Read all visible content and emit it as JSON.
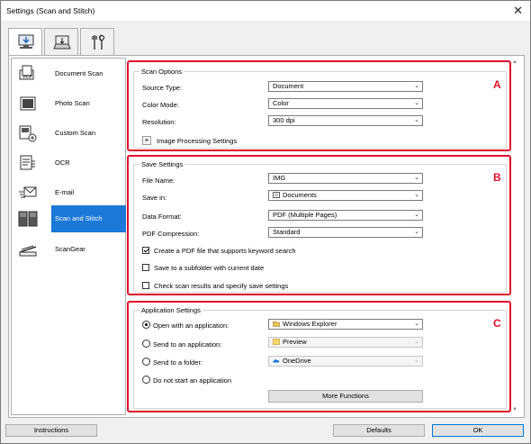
{
  "window": {
    "title": "Settings (Scan and Stitch)",
    "close_glyph": "✕"
  },
  "tabs": [
    {
      "name": "scan-from-computer-tab",
      "icon": "computer-scan-icon"
    },
    {
      "name": "scan-from-operation-panel-tab",
      "icon": "device-scan-icon"
    },
    {
      "name": "general-settings-tab",
      "icon": "tools-icon"
    }
  ],
  "sidebar": {
    "items": [
      {
        "label": "Document Scan",
        "icon": "document-scan-icon"
      },
      {
        "label": "Photo Scan",
        "icon": "photo-scan-icon"
      },
      {
        "label": "Custom Scan",
        "icon": "custom-scan-icon"
      },
      {
        "label": "OCR",
        "icon": "ocr-icon"
      },
      {
        "label": "E-mail",
        "icon": "email-icon"
      },
      {
        "label": "Scan and Stitch",
        "icon": "scan-and-stitch-icon",
        "active": true
      },
      {
        "label": "ScanGear",
        "icon": "scangear-icon"
      }
    ]
  },
  "scan_options": {
    "title": "Scan Options",
    "marker": "A",
    "source_type": {
      "label": "Source Type:",
      "value": "Document"
    },
    "color_mode": {
      "label": "Color Mode:",
      "value": "Color"
    },
    "resolution": {
      "label": "Resolution:",
      "value": "300 dpi"
    },
    "image_processing": {
      "label": "Image Processing Settings",
      "toggle": "+"
    }
  },
  "save_settings": {
    "title": "Save Settings",
    "marker": "B",
    "file_name": {
      "label": "File Name:",
      "value": "IMG"
    },
    "save_in": {
      "label": "Save in:",
      "value": "Documents"
    },
    "data_format": {
      "label": "Data Format:",
      "value": "PDF (Multiple Pages)"
    },
    "pdf_compression": {
      "label": "PDF Compression:",
      "value": "Standard"
    },
    "keyword_search": {
      "label": "Create a PDF file that supports keyword search",
      "checked": true
    },
    "subfolder": {
      "label": "Save to a subfolder with current date",
      "checked": false
    },
    "check_results": {
      "label": "Check scan results and specify save settings",
      "checked": false
    }
  },
  "application_settings": {
    "title": "Application Settings",
    "marker": "C",
    "open_with": {
      "label": "Open with an application:",
      "value": "Windows Explorer",
      "selected": true
    },
    "send_to_app": {
      "label": "Send to an application:",
      "value": "Preview"
    },
    "send_to_folder": {
      "label": "Send to a folder:",
      "value": "OneDrive"
    },
    "do_not_start": {
      "label": "Do not start an application"
    },
    "more_functions": "More Functions"
  },
  "footer": {
    "instructions": "Instructions",
    "defaults": "Defaults",
    "ok": "OK"
  },
  "colors": {
    "accent": "#1b78d6",
    "highlight_box": "#e0102a"
  }
}
